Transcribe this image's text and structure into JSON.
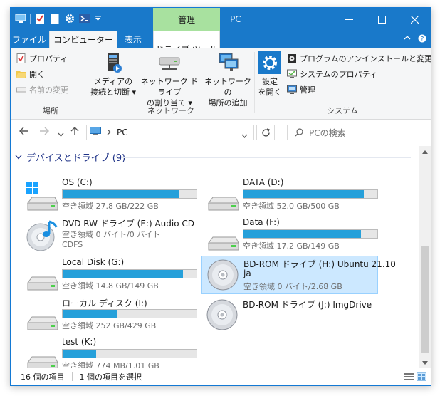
{
  "window": {
    "title": "PC",
    "context_tab": "管理"
  },
  "ribbon_tabs": {
    "file": "ファイル",
    "computer": "コンピューター",
    "view": "表示",
    "drive_tools": "ドライブ ツール"
  },
  "ribbon": {
    "location": {
      "label": "場所",
      "properties": "プロパティ",
      "open": "開く",
      "rename": "名前の変更"
    },
    "network": {
      "label": "ネットワーク",
      "media_line1": "メディアの",
      "media_line2": "接続と切断",
      "map_line1": "ネットワーク ドライブ",
      "map_line2": "の割り当て",
      "add_line1": "ネットワークの",
      "add_line2": "場所の追加"
    },
    "system": {
      "label": "システム",
      "settings_line1": "設定",
      "settings_line2": "を開く",
      "uninstall": "プログラムのアンインストールと変更",
      "sys_props": "システムのプロパティ",
      "manage": "管理"
    }
  },
  "address": {
    "path": "PC",
    "search_placeholder": "PCの検索"
  },
  "section": {
    "title": "デバイスとドライブ (9)"
  },
  "drives": [
    {
      "name": "OS (C:)",
      "free": "空き領域 27.8 GB/222 GB",
      "used_pct": 87
    },
    {
      "name": "DATA (D:)",
      "free": "空き領域 52.0 GB/500 GB",
      "used_pct": 90
    },
    {
      "name": "DVD RW ドライブ (E:) Audio CD",
      "free": "空き領域 0 バイト/0 バイト",
      "fs": "CDFS"
    },
    {
      "name": "Data (F:)",
      "free": "空き領域 17.2 GB/149 GB",
      "used_pct": 88
    },
    {
      "name": "Local Disk (G:)",
      "free": "空き領域 14.8 GB/149 GB",
      "used_pct": 90
    },
    {
      "name_line1": "BD-ROM ドライブ (H:) Ubuntu 21.10",
      "name_line2": "ja",
      "free": "空き領域 0 バイト/2.68 GB"
    },
    {
      "name": "ローカル ディスク (I:)",
      "free": "空き領域 252 GB/429 GB",
      "used_pct": 41
    },
    {
      "name": "BD-ROM ドライブ (J:) ImgDrive"
    },
    {
      "name": "test (K:)",
      "free": "空き領域 774 MB/1.01 GB",
      "used_pct": 25
    }
  ],
  "status": {
    "count": "16 個の項目",
    "selected": "1 個の項目を選択"
  },
  "colors": {
    "accent": "#1979ca",
    "bar": "#26a0da",
    "selection": "#cce8ff",
    "context_tab": "#a8e19f"
  }
}
